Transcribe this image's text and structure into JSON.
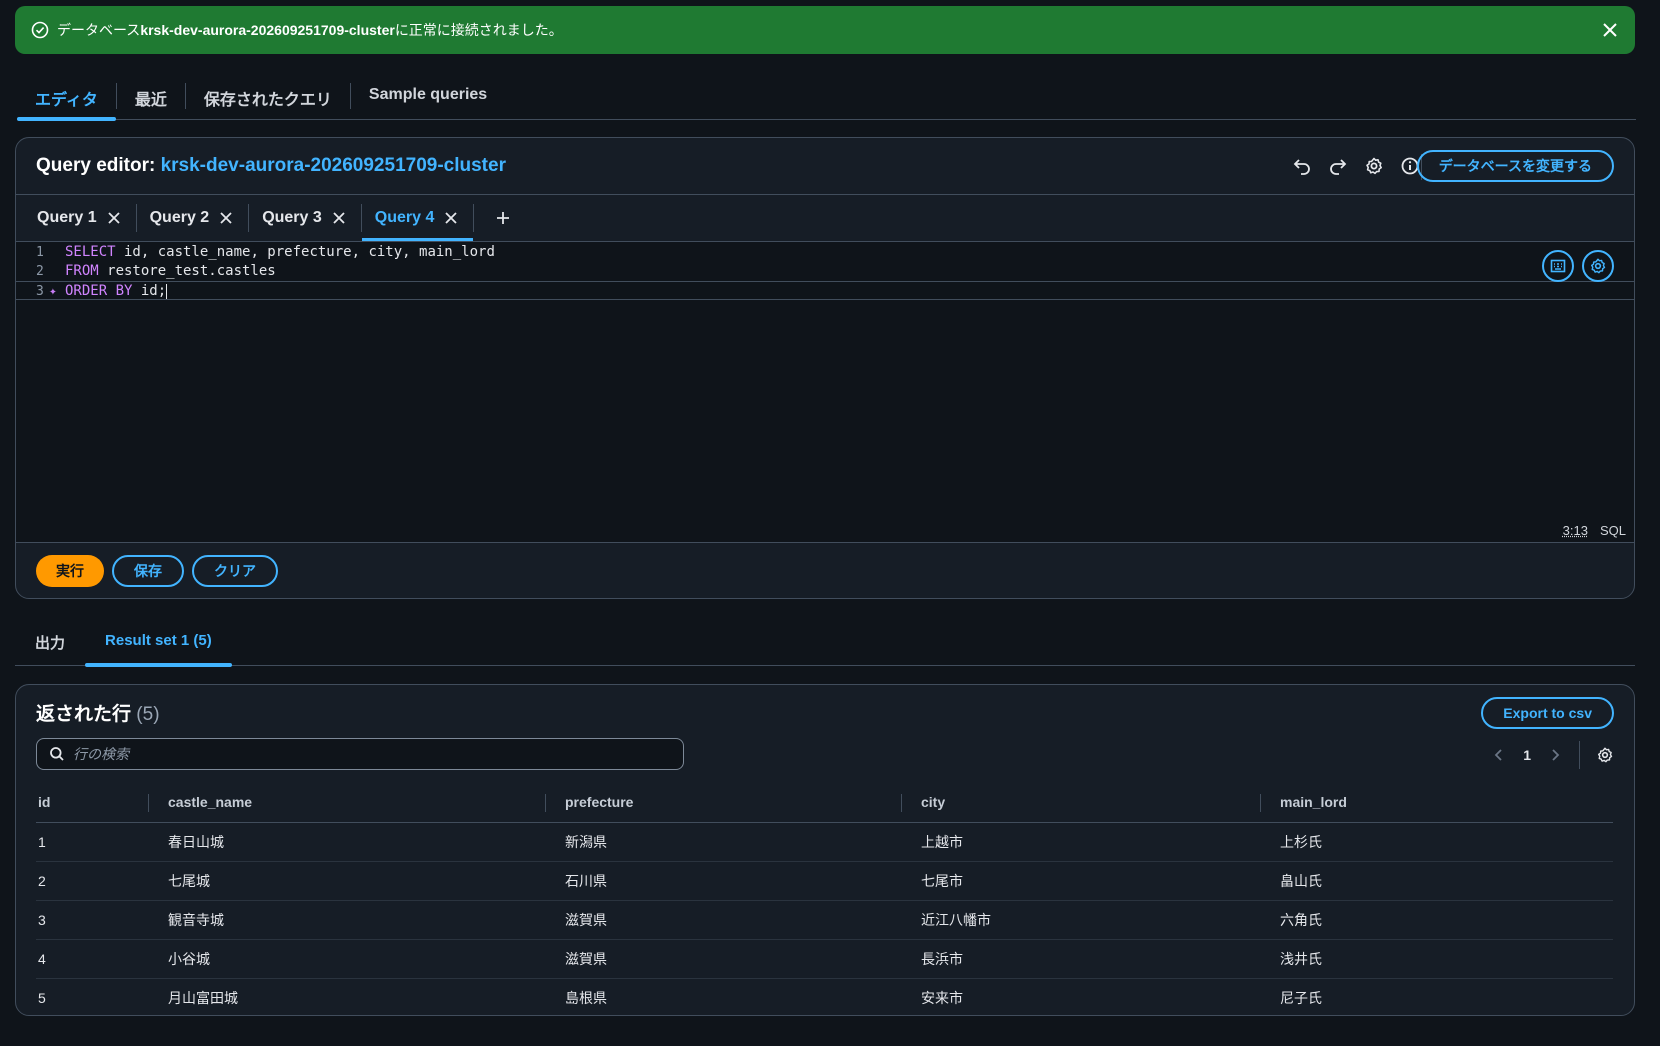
{
  "flash": {
    "prefix": "データベース ",
    "db_name": "krsk-dev-aurora-202609251709-cluster",
    "suffix": " に正常に接続されました。"
  },
  "main_tabs": [
    "エディタ",
    "最近",
    "保存されたクエリ",
    "Sample queries"
  ],
  "editor": {
    "title_prefix": "Query editor: ",
    "cluster": "krsk-dev-aurora-202609251709-cluster",
    "change_db_label": "データベースを変更する",
    "query_tabs": [
      "Query 1",
      "Query 2",
      "Query 3",
      "Query 4"
    ],
    "active_query": "Query 4",
    "lines": [
      {
        "num": "1",
        "kw": "SELECT",
        "rest": " id, castle_name, prefecture, city, main_lord"
      },
      {
        "num": "2",
        "kw": "FROM",
        "rest": " restore_test.castles"
      },
      {
        "num": "3",
        "kw": "ORDER BY",
        "rest": " id;"
      }
    ],
    "cursor_pos": "3:13",
    "language": "SQL",
    "run_label": "実行",
    "save_label": "保存",
    "clear_label": "クリア"
  },
  "result_tabs": [
    "出力",
    "Result set 1 (5)"
  ],
  "results": {
    "title": "返された行",
    "count": "(5)",
    "export_label": "Export to csv",
    "search_placeholder": "行の検索",
    "page": "1",
    "columns": [
      "id",
      "castle_name",
      "prefecture",
      "city",
      "main_lord"
    ],
    "rows": [
      [
        "1",
        "春日山城",
        "新潟県",
        "上越市",
        "上杉氏"
      ],
      [
        "2",
        "七尾城",
        "石川県",
        "七尾市",
        "畠山氏"
      ],
      [
        "3",
        "観音寺城",
        "滋賀県",
        "近江八幡市",
        "六角氏"
      ],
      [
        "4",
        "小谷城",
        "滋賀県",
        "長浜市",
        "浅井氏"
      ],
      [
        "5",
        "月山富田城",
        "島根県",
        "安来市",
        "尼子氏"
      ]
    ]
  },
  "colors": {
    "flash_bg": "#1f7a32",
    "accent": "#42b4ff",
    "primary_button": "#ff9900",
    "background": "#0f141a",
    "panel": "#161d26",
    "sql_keyword": "#d184ff"
  },
  "icons": [
    "check-circle-icon",
    "close-icon",
    "undo-icon",
    "redo-icon",
    "settings-icon",
    "info-icon",
    "keyboard-icon",
    "search-icon",
    "chevron-left-icon",
    "chevron-right-icon",
    "plus-icon"
  ]
}
